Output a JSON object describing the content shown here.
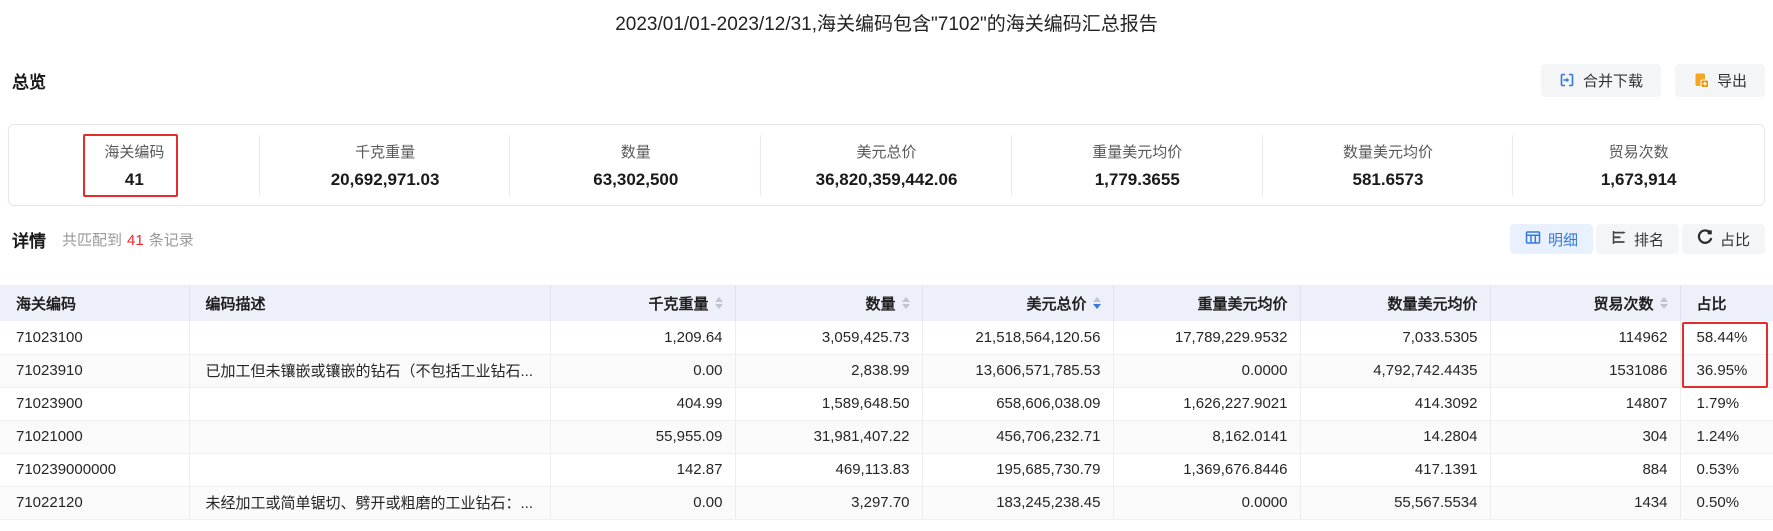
{
  "title": "2023/01/01-2023/12/31,海关编码包含\"7102\"的海关编码汇总报告",
  "overview": {
    "section_label": "总览",
    "buttons": {
      "merge_download": "合并下载",
      "export": "导出"
    },
    "stats": [
      {
        "label": "海关编码",
        "value": "41",
        "highlighted": true
      },
      {
        "label": "千克重量",
        "value": "20,692,971.03"
      },
      {
        "label": "数量",
        "value": "63,302,500"
      },
      {
        "label": "美元总价",
        "value": "36,820,359,442.06"
      },
      {
        "label": "重量美元均价",
        "value": "1,779.3655"
      },
      {
        "label": "数量美元均价",
        "value": "581.6573"
      },
      {
        "label": "贸易次数",
        "value": "1,673,914"
      }
    ]
  },
  "details": {
    "section_label": "详情",
    "match_prefix": "共匹配到",
    "match_count": "41",
    "match_suffix": "条记录",
    "view_buttons": [
      {
        "label": "明细",
        "icon": "table-icon",
        "active": true
      },
      {
        "label": "排名",
        "icon": "ranking-icon",
        "active": false
      },
      {
        "label": "占比",
        "icon": "pie-icon",
        "active": false
      }
    ]
  },
  "table": {
    "columns": [
      {
        "label": "海关编码",
        "sortable": false,
        "align": "left"
      },
      {
        "label": "编码描述",
        "sortable": false,
        "align": "left"
      },
      {
        "label": "千克重量",
        "sortable": true,
        "align": "right"
      },
      {
        "label": "数量",
        "sortable": true,
        "align": "right"
      },
      {
        "label": "美元总价",
        "sortable": true,
        "sort": "desc",
        "align": "right"
      },
      {
        "label": "重量美元均价",
        "sortable": false,
        "align": "right"
      },
      {
        "label": "数量美元均价",
        "sortable": false,
        "align": "right"
      },
      {
        "label": "贸易次数",
        "sortable": true,
        "align": "right"
      },
      {
        "label": "占比",
        "sortable": false,
        "align": "left"
      }
    ],
    "rows": [
      [
        "71023100",
        "",
        "1,209.64",
        "3,059,425.73",
        "21,518,564,120.56",
        "17,789,229.9532",
        "7,033.5305",
        "114962",
        "58.44%"
      ],
      [
        "71023910",
        "已加工但未镶嵌或镶嵌的钻石（不包括工业钻石...",
        "0.00",
        "2,838.99",
        "13,606,571,785.53",
        "0.0000",
        "4,792,742.4435",
        "1531086",
        "36.95%"
      ],
      [
        "71023900",
        "",
        "404.99",
        "1,589,648.50",
        "658,606,038.09",
        "1,626,227.9021",
        "414.3092",
        "14807",
        "1.79%"
      ],
      [
        "71021000",
        "",
        "55,955.09",
        "31,981,407.22",
        "456,706,232.71",
        "8,162.0141",
        "14.2804",
        "304",
        "1.24%"
      ],
      [
        "710239000000",
        "",
        "142.87",
        "469,113.83",
        "195,685,730.79",
        "1,369,676.8446",
        "417.1391",
        "884",
        "0.53%"
      ],
      [
        "71022120",
        "未经加工或简单锯切、劈开或粗磨的工业钻石：...",
        "0.00",
        "3,297.70",
        "183,245,238.45",
        "0.0000",
        "55,567.5534",
        "1434",
        "0.50%"
      ]
    ]
  },
  "colors": {
    "accent_blue": "#3579de",
    "accent_orange": "#f5a623",
    "highlight_red": "#e62b2b",
    "text_red": "#f5222d"
  }
}
